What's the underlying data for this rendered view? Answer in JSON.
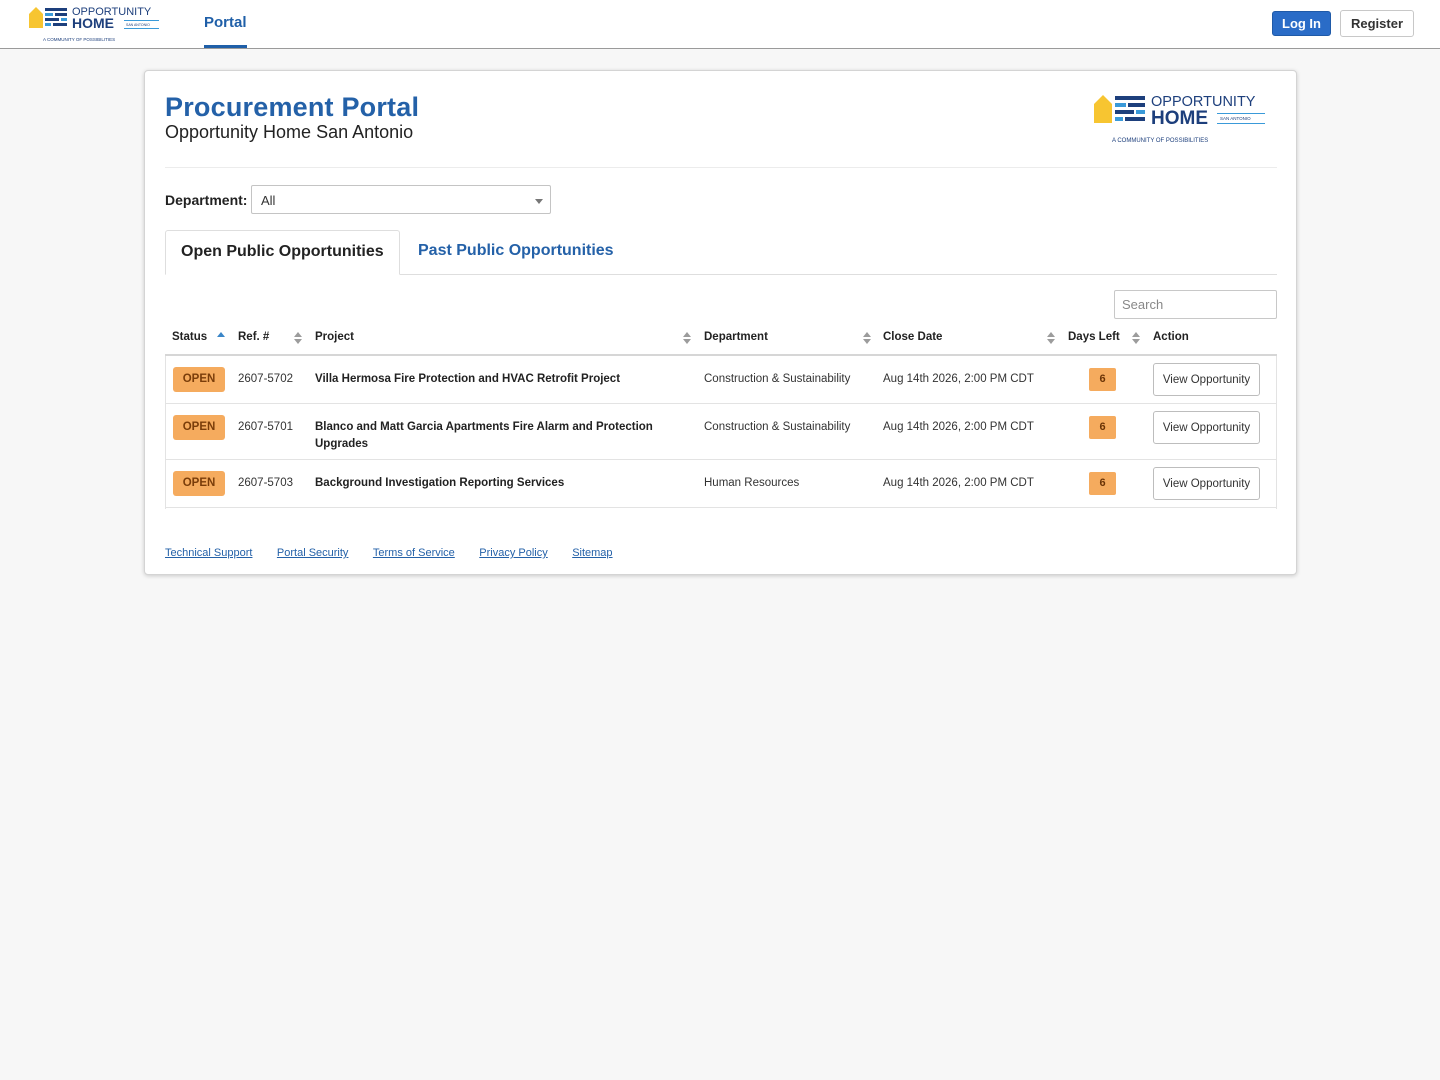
{
  "nav": {
    "logo": {
      "line1": "OPPORTUNITY",
      "line2": "HOME",
      "tag": "SAN ANTONIO",
      "tagline": "A COMMUNITY OF POSSIBILITIES"
    },
    "portal_label": "Portal",
    "login_label": "Log In",
    "register_label": "Register"
  },
  "header": {
    "title": "Procurement Portal",
    "subtitle": "Opportunity Home San Antonio"
  },
  "filter": {
    "department_label": "Department:",
    "department_value": "All"
  },
  "tabs": {
    "open_label": "Open Public Opportunities",
    "past_label": "Past Public Opportunities"
  },
  "search": {
    "placeholder": "Search"
  },
  "table": {
    "columns": [
      "Status",
      "Ref. #",
      "Project",
      "Department",
      "Close Date",
      "Days Left",
      "Action"
    ],
    "rows": [
      {
        "status": "OPEN",
        "ref": "2607-5702",
        "project": "Villa Hermosa Fire Protection and HVAC Retrofit Project",
        "department": "Construction & Sustainability",
        "close_date": "Aug 14th 2026, 2:00 PM CDT",
        "days_left": "6",
        "action": "View Opportunity"
      },
      {
        "status": "OPEN",
        "ref": "2607-5701",
        "project": "Blanco and Matt Garcia Apartments Fire Alarm and Protection Upgrades",
        "department": "Construction & Sustainability",
        "close_date": "Aug 14th 2026, 2:00 PM CDT",
        "days_left": "6",
        "action": "View Opportunity"
      },
      {
        "status": "OPEN",
        "ref": "2607-5703",
        "project": "Background Investigation Reporting Services",
        "department": "Human Resources",
        "close_date": "Aug 14th 2026, 2:00 PM CDT",
        "days_left": "6",
        "action": "View Opportunity"
      }
    ]
  },
  "footer": {
    "links": [
      "Technical Support",
      "Portal Security",
      "Terms of Service",
      "Privacy Policy",
      "Sitemap"
    ]
  },
  "colors": {
    "brand_blue": "#2461a8",
    "button_blue": "#2a6cc7",
    "status_orange": "#f5ab5e",
    "logo_yellow": "#f7c531",
    "logo_navy": "#1d3f7c"
  }
}
